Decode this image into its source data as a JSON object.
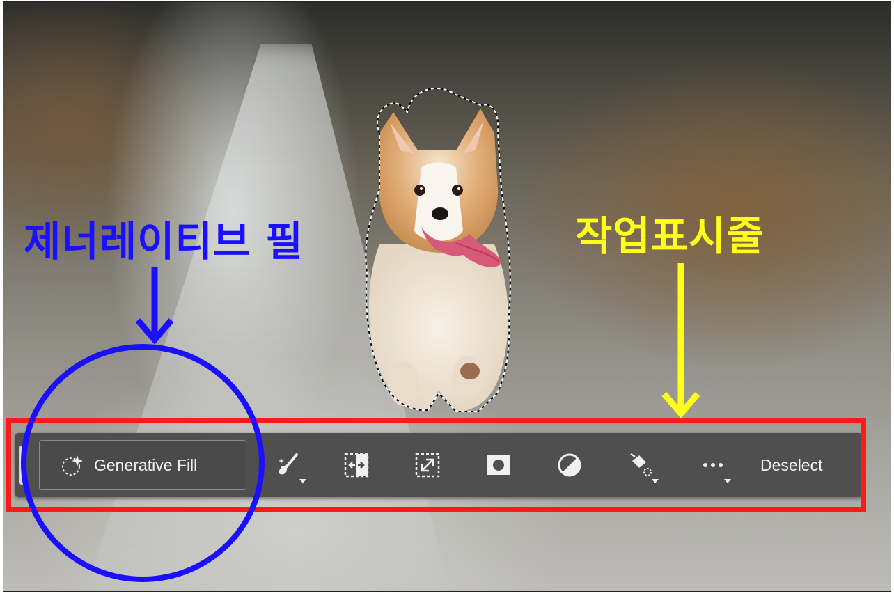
{
  "toolbar": {
    "generative_fill_label": "Generative Fill",
    "deselect_label": "Deselect",
    "tools": [
      {
        "name": "modify-selection-brush",
        "icon": "brush-sparkle-icon",
        "has_dropdown": true
      },
      {
        "name": "invert-selection",
        "icon": "invert-selection-icon",
        "has_dropdown": false
      },
      {
        "name": "transform-selection",
        "icon": "transform-selection-icon",
        "has_dropdown": false
      },
      {
        "name": "create-mask",
        "icon": "mask-icon",
        "has_dropdown": false
      },
      {
        "name": "adjustment-layer",
        "icon": "half-circle-icon",
        "has_dropdown": false
      },
      {
        "name": "fill-selection",
        "icon": "paint-bucket-icon",
        "has_dropdown": true
      },
      {
        "name": "more-options",
        "icon": "ellipsis-icon",
        "has_dropdown": true
      }
    ]
  },
  "annotations": {
    "generative_fill_label": "제너레이티브 필",
    "taskbar_label": "작업표시줄",
    "colors": {
      "frame": "#ff1a1a",
      "generative_fill": "#1a10ff",
      "taskbar": "#ffff1a"
    }
  }
}
